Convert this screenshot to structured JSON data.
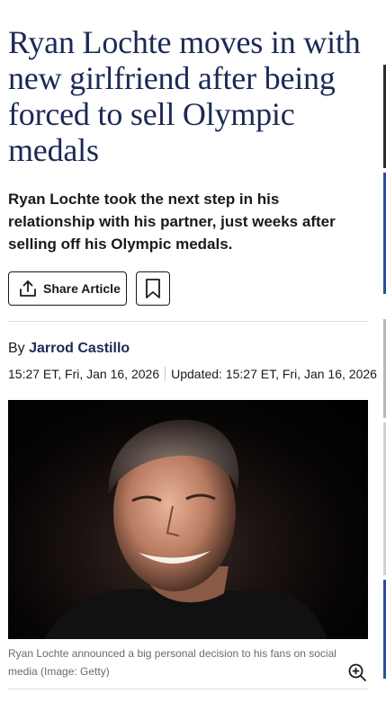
{
  "article": {
    "headline": "Ryan Lochte moves in with new girlfriend after being forced to sell Olympic medals",
    "subhead": "Ryan Lochte took the next step in his relationship with his partner, just weeks after selling off his Olympic medals.",
    "share_label": "Share Article",
    "byline_prefix": "By",
    "author": "Jarrod Castillo",
    "published": "15:27 ET, Fri, Jan 16, 2026",
    "updated": "Updated: 15:27 ET, Fri, Jan 16, 2026",
    "caption": "Ryan Lochte announced a big personal decision to his fans on social media",
    "credit": "(Image: Getty)"
  },
  "icons": {
    "share": "share-icon",
    "bookmark": "bookmark-icon",
    "zoom": "zoom-in-icon"
  },
  "colors": {
    "headline": "#1b2a55",
    "author": "#1b2a55",
    "caption": "#6a6a6a"
  }
}
